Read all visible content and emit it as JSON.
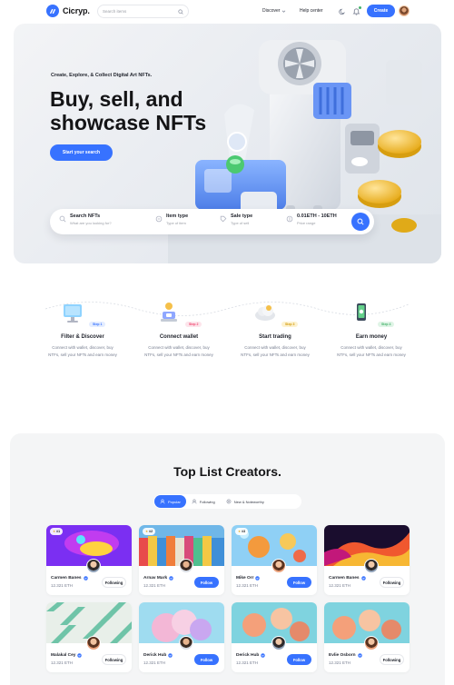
{
  "header": {
    "logo_text": "Cicryp.",
    "search_placeholder": "Search items",
    "nav_discover": "Discover",
    "nav_help": "Help center",
    "create_label": "Create"
  },
  "hero": {
    "eyebrow": "Create, Explore, & Collect Digital Art NFTs.",
    "title": "Buy, sell, and showcase NFTs",
    "cta": "Start your search",
    "filters": [
      {
        "title": "Search NFTs",
        "sub": "What are you looking for?"
      },
      {
        "title": "Item type",
        "sub": "Type of item"
      },
      {
        "title": "Sale type",
        "sub": "Type of sell"
      },
      {
        "title": "0.01ETH - 10ETH",
        "sub": "Price range"
      }
    ]
  },
  "steps": [
    {
      "badge": "Step 1",
      "title": "Filter & Discover",
      "desc": "Connect with wallet, discover, buy NTFs, sell your NFTs and earn money",
      "color": "#3772ff",
      "bg": "#e4edff"
    },
    {
      "badge": "Step 2",
      "title": "Connect wallet",
      "desc": "Connect with wallet, discover, buy NTFs, sell your NFTs and earn money",
      "color": "#ef466f",
      "bg": "#fde4eb"
    },
    {
      "badge": "Step 3",
      "title": "Start trading",
      "desc": "Connect with wallet, discover, buy NTFs, sell your NFTs and earn money",
      "color": "#d39a0b",
      "bg": "#fdf2cf"
    },
    {
      "badge": "Step 4",
      "title": "Earn money",
      "desc": "Connect with wallet, discover, buy NTFs, sell your NFTs and earn money",
      "color": "#45b26b",
      "bg": "#dff4e6"
    }
  ],
  "creators": {
    "title": "Top List Creators.",
    "tabs": [
      "Popular",
      "Following",
      "New & Noteworthy"
    ],
    "cards": [
      {
        "badge": "#1",
        "name": "Carmen Banes",
        "price": "12.321 ETH",
        "action": "Following"
      },
      {
        "badge": "#2",
        "name": "Arnav Mark",
        "price": "12.321 ETH",
        "action": "Follow"
      },
      {
        "badge": "#3",
        "name": "Mike Orr",
        "price": "12.321 ETH",
        "action": "Follow"
      },
      {
        "badge": "",
        "name": "Carmen Banes",
        "price": "12.321 ETH",
        "action": "Following"
      },
      {
        "badge": "",
        "name": "Malakal Cey",
        "price": "12.321 ETH",
        "action": "Following"
      },
      {
        "badge": "",
        "name": "Derick Hub",
        "price": "12.321 ETH",
        "action": "Follow"
      },
      {
        "badge": "",
        "name": "Derick Hub",
        "price": "12.321 ETH",
        "action": "Follow"
      },
      {
        "badge": "",
        "name": "Evlie Osborn",
        "price": "12.321 ETH",
        "action": "Following"
      }
    ]
  },
  "colors": {
    "accent": "#3772ff",
    "background": "#ffffff",
    "section": "#f4f5f6"
  }
}
